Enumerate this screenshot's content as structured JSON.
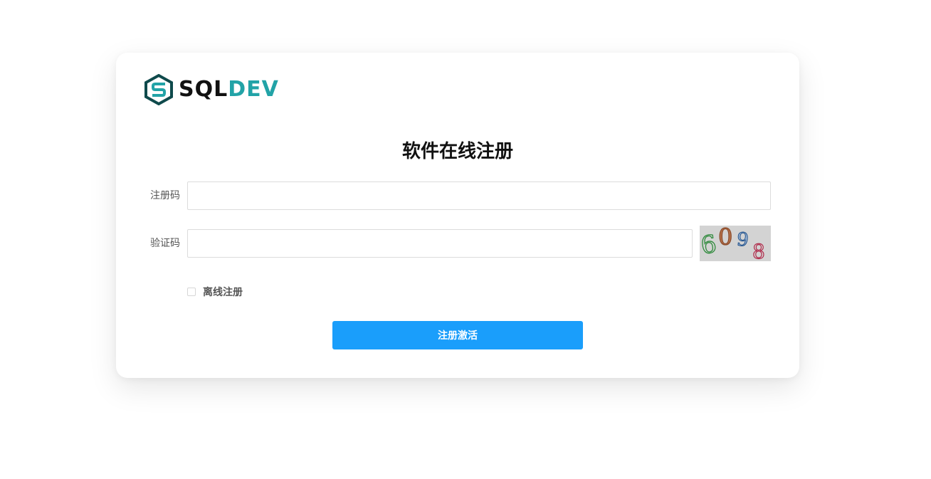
{
  "logo": {
    "icon": "sqldev-hexagon-logo",
    "text_part1": "SQL",
    "text_part2": "DEV",
    "color_dark": "#0f4a4c",
    "color_accent": "#22a3a7"
  },
  "title": "软件在线注册",
  "form": {
    "reg_code_label": "注册码",
    "reg_code_value": "",
    "captcha_label": "验证码",
    "captcha_value": "",
    "captcha_image_text": "6098",
    "offline_label": "离线注册",
    "offline_checked": false,
    "submit_label": "注册激活"
  },
  "colors": {
    "primary_button": "#1a9efb",
    "captcha_bg": "#d3d3d3"
  }
}
